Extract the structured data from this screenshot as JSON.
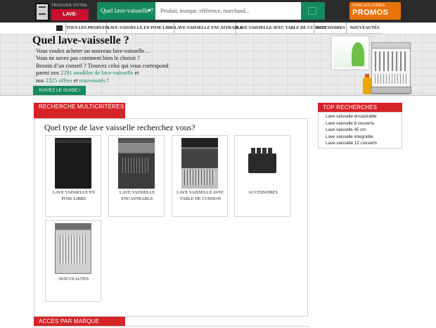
{
  "header": {
    "logo": {
      "small": "TROUVER VOTRE",
      "big": "LAVE-VAISSELLE"
    },
    "search": {
      "category": "Quel lave-vaisselle ?",
      "placeholder": "Produit, marque, référence, marchand..."
    },
    "promo": {
      "small": "VOIR LES CODES",
      "big": "PROMOS"
    }
  },
  "nav": {
    "items": [
      "TOUS LES PRODUITS",
      "LAVE-VAISSELLE EN POSE LIBRE",
      "LAVE-VAISSELLE ENCASTRABLE",
      "LAVE-VAISSELLE AVEC TABLE DE CUISSON",
      "ACCESSOIRES",
      "NOUVEAUTÉS"
    ]
  },
  "hero": {
    "title": "Quel lave-vaisselle ?",
    "line1": "Vous voulez acheter un nouveau lave-vaisselle…",
    "line2": "Vous ne savez pas comment bien le choisir ?",
    "line3": "Besoin d’un conseil ? Trouvez celui qui vous correspond",
    "line4_pre": "parmi nos ",
    "line4_link": "2291 modèles de lave-vaisselle",
    "line4_post": " et",
    "line5_pre": "nos ",
    "line5_offers": "2325 offres",
    "line5_mid": " et ",
    "line5_new": "nouveautés",
    "line5_post": " !",
    "cta": "SUIVEZ LE GUIDE !"
  },
  "main": {
    "panel_title": "RECHERCHE MULTICRITÈRES",
    "question": "Quel type de lave vaisselle recherchez vous?",
    "categories": [
      {
        "label": "LAVE VAISSELLE EN POSE LIBRE"
      },
      {
        "label": "LAVE VAISSELLE ENCASTRABLE"
      },
      {
        "label": "LAVE VAISSELLE AVEC TABLE DE CUISSON"
      },
      {
        "label": "ACCESSOIRES"
      },
      {
        "label": "NOUVEAUTES"
      }
    ],
    "brand_title": "ACCÈS PAR MARQUE"
  },
  "sidebar": {
    "title": "TOP RECHERCHES",
    "items": [
      "Lave vaisselle encastrable",
      "Lave vaisselle 6 couverts",
      "Lave vaisselle 45 cm",
      "Lave vaisselle integrable",
      "Lave-vaisselle 12 couverts"
    ]
  },
  "colors": {
    "accent_red": "#d42427",
    "accent_green": "#158a5e",
    "promo_orange": "#e8720c",
    "topbar": "#2b2b2b"
  }
}
